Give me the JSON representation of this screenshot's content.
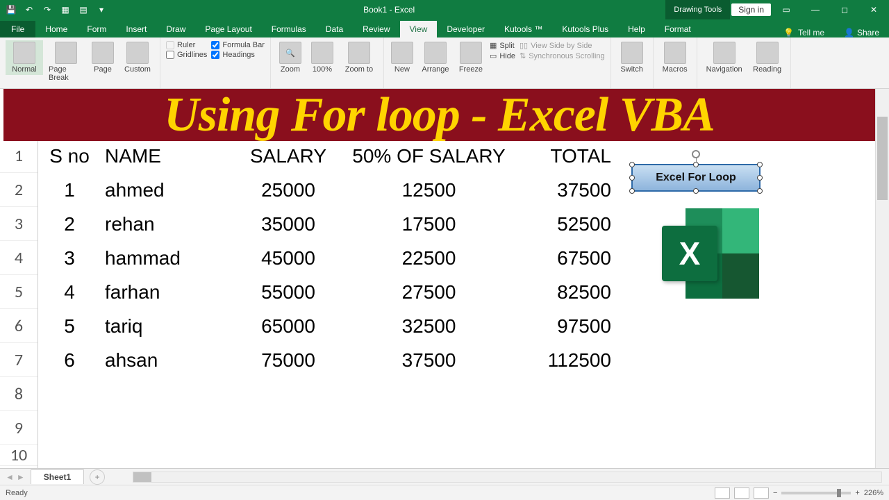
{
  "titlebar": {
    "doc": "Book1  -  Excel",
    "context_tab": "Drawing Tools",
    "signin": "Sign in"
  },
  "tabs": {
    "file": "File",
    "items": [
      "Home",
      "Form",
      "Insert",
      "Draw",
      "Page Layout",
      "Formulas",
      "Data",
      "Review",
      "View",
      "Developer",
      "Kutools ™",
      "Kutools Plus",
      "Help"
    ],
    "format": "Format",
    "tellme": "Tell me",
    "share": "Share"
  },
  "ribbon": {
    "views": [
      "Normal",
      "Page Break",
      "Page",
      "Custom"
    ],
    "show": {
      "ruler": "Ruler",
      "formula": "Formula Bar",
      "grid": "Gridlines",
      "head": "Headings"
    },
    "zoom": [
      "Zoom",
      "100%",
      "Zoom to"
    ],
    "window": [
      "New",
      "Arrange",
      "Freeze"
    ],
    "winopts": [
      "Split",
      "Hide"
    ],
    "sidebyside": "View Side by Side",
    "syncscroll": "Synchronous Scrolling",
    "switch": "Switch",
    "macros": "Macros",
    "nav": "Navigation",
    "reading": "Reading"
  },
  "overlay": "Using For loop - Excel VBA",
  "headers": {
    "sno": "S no",
    "name": "NAME",
    "sal": "SALARY",
    "pct": "50% OF SALARY",
    "tot": "TOTAL"
  },
  "rows": [
    {
      "n": "1",
      "sno": "1",
      "name": "ahmed",
      "sal": "25000",
      "pct": "12500",
      "tot": "37500"
    },
    {
      "n": "2",
      "sno": "2",
      "name": "rehan",
      "sal": "35000",
      "pct": "17500",
      "tot": "52500"
    },
    {
      "n": "3",
      "sno": "3",
      "name": "hammad",
      "sal": "45000",
      "pct": "22500",
      "tot": "67500"
    },
    {
      "n": "4",
      "sno": "4",
      "name": "farhan",
      "sal": "55000",
      "pct": "27500",
      "tot": "82500"
    },
    {
      "n": "5",
      "sno": "5",
      "name": "tariq",
      "sal": "65000",
      "pct": "32500",
      "tot": "97500"
    },
    {
      "n": "6",
      "sno": "6",
      "name": "ahsan",
      "sal": "75000",
      "pct": "37500",
      "tot": "112500"
    }
  ],
  "row_nums": [
    "1",
    "2",
    "3",
    "4",
    "5",
    "6",
    "7",
    "8",
    "9",
    "10"
  ],
  "shape_label": "Excel For Loop",
  "sheet": "Sheet1",
  "status": {
    "ready": "Ready",
    "zoom": "226%"
  }
}
